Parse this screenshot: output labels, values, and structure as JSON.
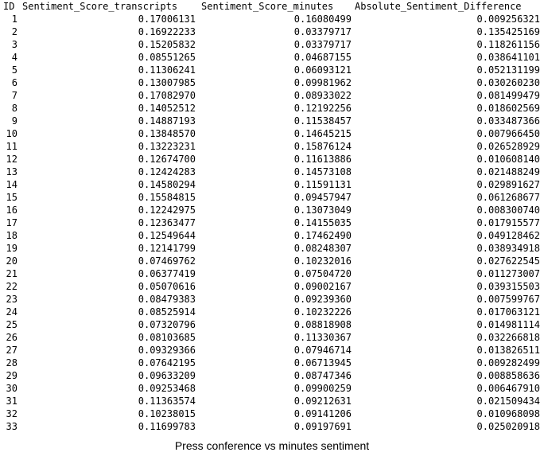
{
  "table": {
    "headers": [
      "ID",
      "Sentiment_Score_transcripts",
      "Sentiment_Score_minutes",
      "Absolute_Sentiment_Difference"
    ],
    "rows": [
      [
        "1",
        "0.17006131",
        "0.16080499",
        "0.009256321"
      ],
      [
        "2",
        "0.16922233",
        "0.03379717",
        "0.135425169"
      ],
      [
        "3",
        "0.15205832",
        "0.03379717",
        "0.118261156"
      ],
      [
        "4",
        "0.08551265",
        "0.04687155",
        "0.038641101"
      ],
      [
        "5",
        "0.11306241",
        "0.06093121",
        "0.052131199"
      ],
      [
        "6",
        "0.13007985",
        "0.09981962",
        "0.030260230"
      ],
      [
        "7",
        "0.17082970",
        "0.08933022",
        "0.081499479"
      ],
      [
        "8",
        "0.14052512",
        "0.12192256",
        "0.018602569"
      ],
      [
        "9",
        "0.14887193",
        "0.11538457",
        "0.033487366"
      ],
      [
        "10",
        "0.13848570",
        "0.14645215",
        "0.007966450"
      ],
      [
        "11",
        "0.13223231",
        "0.15876124",
        "0.026528929"
      ],
      [
        "12",
        "0.12674700",
        "0.11613886",
        "0.010608140"
      ],
      [
        "13",
        "0.12424283",
        "0.14573108",
        "0.021488249"
      ],
      [
        "14",
        "0.14580294",
        "0.11591131",
        "0.029891627"
      ],
      [
        "15",
        "0.15584815",
        "0.09457947",
        "0.061268677"
      ],
      [
        "16",
        "0.12242975",
        "0.13073049",
        "0.008300740"
      ],
      [
        "17",
        "0.12363477",
        "0.14155035",
        "0.017915577"
      ],
      [
        "18",
        "0.12549644",
        "0.17462490",
        "0.049128462"
      ],
      [
        "19",
        "0.12141799",
        "0.08248307",
        "0.038934918"
      ],
      [
        "20",
        "0.07469762",
        "0.10232016",
        "0.027622545"
      ],
      [
        "21",
        "0.06377419",
        "0.07504720",
        "0.011273007"
      ],
      [
        "22",
        "0.05070616",
        "0.09002167",
        "0.039315503"
      ],
      [
        "23",
        "0.08479383",
        "0.09239360",
        "0.007599767"
      ],
      [
        "24",
        "0.08525914",
        "0.10232226",
        "0.017063121"
      ],
      [
        "25",
        "0.07320796",
        "0.08818908",
        "0.014981114"
      ],
      [
        "26",
        "0.08103685",
        "0.11330367",
        "0.032266818"
      ],
      [
        "27",
        "0.09329366",
        "0.07946714",
        "0.013826511"
      ],
      [
        "28",
        "0.07642195",
        "0.06713945",
        "0.009282499"
      ],
      [
        "29",
        "0.09633209",
        "0.08747346",
        "0.008858636"
      ],
      [
        "30",
        "0.09253468",
        "0.09900259",
        "0.006467910"
      ],
      [
        "31",
        "0.11363574",
        "0.09212631",
        "0.021509434"
      ],
      [
        "32",
        "0.10238015",
        "0.09141206",
        "0.010968098"
      ],
      [
        "33",
        "0.11699783",
        "0.09197691",
        "0.025020918"
      ]
    ]
  },
  "caption": "Press conference vs minutes sentiment"
}
